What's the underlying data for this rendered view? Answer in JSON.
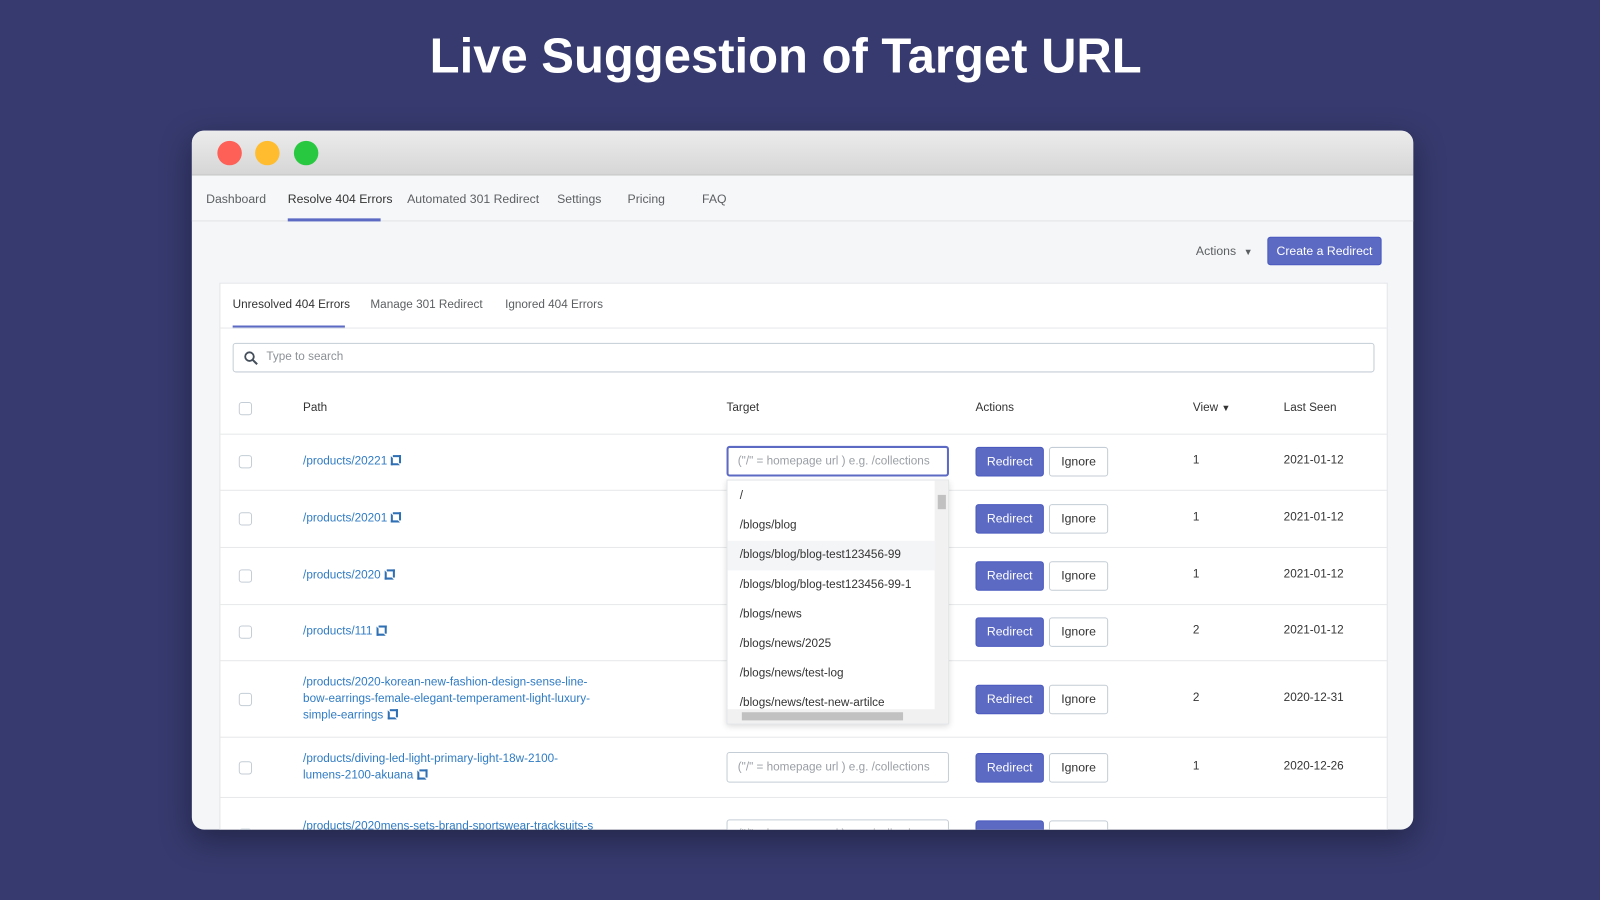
{
  "headline": "Live Suggestion of Target URL",
  "window": {
    "traffic_lights": [
      "#fe5f57",
      "#febc2e",
      "#28c840"
    ]
  },
  "nav": {
    "items": [
      "Dashboard",
      "Resolve 404 Errors",
      "Automated 301 Redirect",
      "Settings",
      "Pricing",
      "FAQ"
    ],
    "active": "Resolve 404 Errors"
  },
  "toolbar": {
    "actions_label": "Actions",
    "create_label": "Create a Redirect"
  },
  "subtabs": {
    "items": [
      "Unresolved 404 Errors",
      "Manage 301 Redirect",
      "Ignored 404 Errors"
    ],
    "active": "Unresolved 404 Errors"
  },
  "search": {
    "placeholder": "Type to search"
  },
  "table": {
    "headers": {
      "path": "Path",
      "target": "Target",
      "actions": "Actions",
      "view": "View",
      "last_seen": "Last Seen"
    },
    "target_placeholder": "(\"/\" = homepage url ) e.g. /collections",
    "redirect_label": "Redirect",
    "ignore_label": "Ignore",
    "rows": [
      {
        "path": "/products/20221",
        "view": "1",
        "last_seen": "2021-01-12"
      },
      {
        "path": "/products/20201",
        "view": "1",
        "last_seen": "2021-01-12"
      },
      {
        "path": "/products/2020",
        "view": "1",
        "last_seen": "2021-01-12"
      },
      {
        "path": "/products/111",
        "view": "2",
        "last_seen": "2021-01-12"
      },
      {
        "path": "/products/2020-korean-new-fashion-design-sense-line-bow-earrings-female-elegant-temperament-light-luxury-simple-earrings",
        "view": "2",
        "last_seen": "2020-12-31"
      },
      {
        "path": "/products/diving-led-light-primary-light-18w-2100-lumens-2100-akuana",
        "view": "1",
        "last_seen": "2020-12-26"
      },
      {
        "path": "/products/2020mens-sets-brand-sportswear-tracksuits-s",
        "view": "",
        "last_seen": ""
      }
    ]
  },
  "suggestions": {
    "items": [
      "/",
      "/blogs/blog",
      "/blogs/blog/blog-test123456-99",
      "/blogs/blog/blog-test123456-99-1",
      "/blogs/news",
      "/blogs/news/2025",
      "/blogs/news/test-log",
      "/blogs/news/test-new-artilce"
    ],
    "highlighted": "/blogs/blog/blog-test123456-99"
  },
  "colors": {
    "accent": "#5c6ac4",
    "link": "#2f7bc4",
    "background": "#363a6e"
  }
}
